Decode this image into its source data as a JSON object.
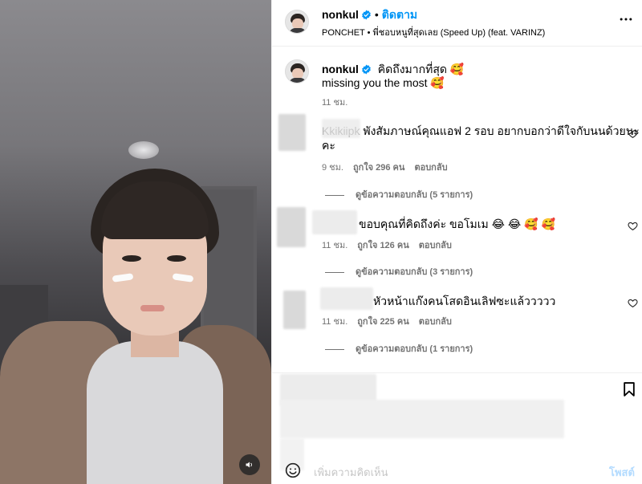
{
  "post": {
    "username": "nonkul",
    "follow_separator": "•",
    "follow_label": "ติดตาม",
    "music": "PONCHET • พี่ชอบหนูที่สุดเลย (Speed Up) (feat. VARINZ)"
  },
  "caption": {
    "username": "nonkul",
    "line1": "คิดถึงมากที่สุด 🥰",
    "line2": "missing you the most 🥰",
    "time": "11 ชม."
  },
  "comments": [
    {
      "text_line1": "Kkikiipk พังสัมภาษณ์คุณแอฟ 2 รอบ อยากบอกว่าดีใจกับนนด้วยนะ",
      "text_line2": "คะ",
      "time": "9 ชม.",
      "likes": "ถูกใจ 296 คน",
      "reply": "ตอบกลับ",
      "view_replies": "ดูข้อความตอบกลับ (5 รายการ)"
    },
    {
      "text_line1": "ขอบคุณที่คิดถึงค่ะ ขอโมเม 😂 😂 🥰 🥰",
      "text_line2": "",
      "time": "11 ชม.",
      "likes": "ถูกใจ 126 คน",
      "reply": "ตอบกลับ",
      "view_replies": "ดูข้อความตอบกลับ (3 รายการ)"
    },
    {
      "text_line1": "หัวหน้าแก๊งคนโสดอินเลิฟซะแล้ววววว",
      "text_line2": "",
      "time": "11 ชม.",
      "likes": "ถูกใจ 225 คน",
      "reply": "ตอบกลับ",
      "view_replies": "ดูข้อความตอบกลับ (1 รายการ)"
    }
  ],
  "composer": {
    "placeholder": "เพิ่มความคิดเห็น",
    "post_label": "โพสต์"
  },
  "colors": {
    "accent": "#0095f6",
    "verified": "#0095f6",
    "secondary_text": "#737373",
    "post_disabled": "#b3dbff"
  },
  "icons": {
    "verified": "verified-badge-icon",
    "more": "more-horizontal-icon",
    "heart": "heart-outline-icon",
    "bookmark": "bookmark-icon",
    "emoji": "emoji-icon",
    "sound": "speaker-icon"
  }
}
